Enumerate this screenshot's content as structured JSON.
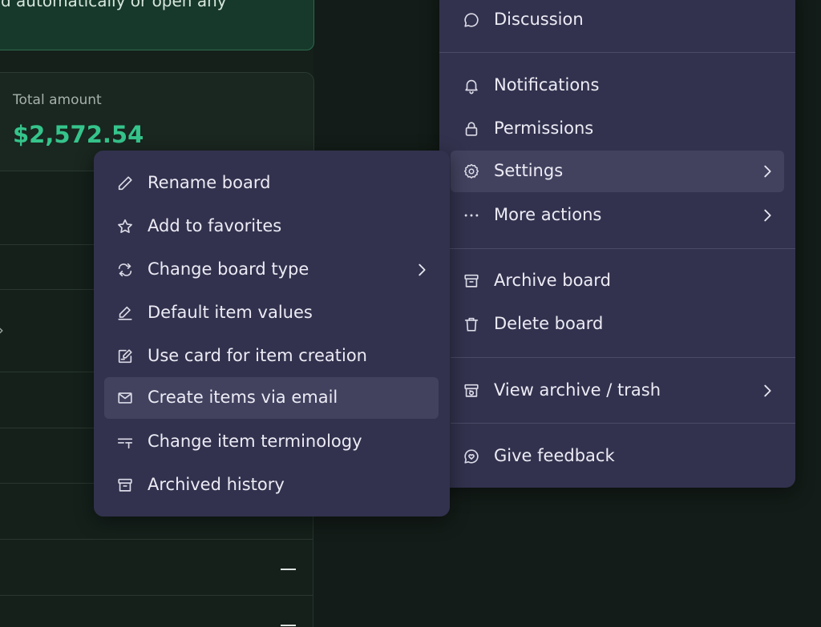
{
  "background_card": {
    "text": "d automatically   or open any"
  },
  "total_card": {
    "label": "Total amount",
    "value": "$2,572.54"
  },
  "right_menu": {
    "items": [
      {
        "label": "Discussion",
        "icon": "chat-bubble-icon"
      },
      {
        "label": "Notifications",
        "icon": "bell-icon"
      },
      {
        "label": "Permissions",
        "icon": "lock-icon"
      },
      {
        "label": "Settings",
        "icon": "gear-icon",
        "submenu": true,
        "highlighted": true
      },
      {
        "label": "More actions",
        "icon": "ellipsis-icon",
        "submenu": true
      },
      {
        "label": "Archive board",
        "icon": "archive-box-icon"
      },
      {
        "label": "Delete board",
        "icon": "trash-icon"
      },
      {
        "label": "View archive / trash",
        "icon": "archive-view-icon",
        "submenu": true
      },
      {
        "label": "Give feedback",
        "icon": "feedback-heart-icon"
      }
    ]
  },
  "settings_submenu": {
    "items": [
      {
        "label": "Rename board",
        "icon": "pencil-icon"
      },
      {
        "label": "Add to favorites",
        "icon": "star-icon"
      },
      {
        "label": "Change board type",
        "icon": "swap-arrows-icon",
        "submenu": true
      },
      {
        "label": "Default item values",
        "icon": "pencil-line-icon"
      },
      {
        "label": "Use card for item creation",
        "icon": "edit-card-icon"
      },
      {
        "label": "Create items via email",
        "icon": "envelope-icon",
        "highlighted": true
      },
      {
        "label": "Change item terminology",
        "icon": "text-format-icon"
      },
      {
        "label": "Archived history",
        "icon": "archive-box-icon"
      }
    ]
  },
  "colors": {
    "menu_bg": "#32324e",
    "highlight_bg": "#42425f",
    "amount_green": "#35c48b",
    "page_bg": "#15201b"
  }
}
